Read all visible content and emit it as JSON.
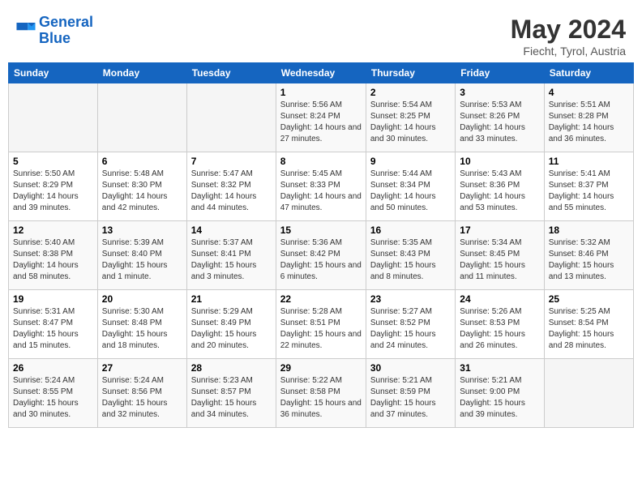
{
  "logo": {
    "line1": "General",
    "line2": "Blue"
  },
  "title": "May 2024",
  "location": "Fiecht, Tyrol, Austria",
  "days_of_week": [
    "Sunday",
    "Monday",
    "Tuesday",
    "Wednesday",
    "Thursday",
    "Friday",
    "Saturday"
  ],
  "weeks": [
    [
      {
        "num": "",
        "info": ""
      },
      {
        "num": "",
        "info": ""
      },
      {
        "num": "",
        "info": ""
      },
      {
        "num": "1",
        "info": "Sunrise: 5:56 AM\nSunset: 8:24 PM\nDaylight: 14 hours and 27 minutes."
      },
      {
        "num": "2",
        "info": "Sunrise: 5:54 AM\nSunset: 8:25 PM\nDaylight: 14 hours and 30 minutes."
      },
      {
        "num": "3",
        "info": "Sunrise: 5:53 AM\nSunset: 8:26 PM\nDaylight: 14 hours and 33 minutes."
      },
      {
        "num": "4",
        "info": "Sunrise: 5:51 AM\nSunset: 8:28 PM\nDaylight: 14 hours and 36 minutes."
      }
    ],
    [
      {
        "num": "5",
        "info": "Sunrise: 5:50 AM\nSunset: 8:29 PM\nDaylight: 14 hours and 39 minutes."
      },
      {
        "num": "6",
        "info": "Sunrise: 5:48 AM\nSunset: 8:30 PM\nDaylight: 14 hours and 42 minutes."
      },
      {
        "num": "7",
        "info": "Sunrise: 5:47 AM\nSunset: 8:32 PM\nDaylight: 14 hours and 44 minutes."
      },
      {
        "num": "8",
        "info": "Sunrise: 5:45 AM\nSunset: 8:33 PM\nDaylight: 14 hours and 47 minutes."
      },
      {
        "num": "9",
        "info": "Sunrise: 5:44 AM\nSunset: 8:34 PM\nDaylight: 14 hours and 50 minutes."
      },
      {
        "num": "10",
        "info": "Sunrise: 5:43 AM\nSunset: 8:36 PM\nDaylight: 14 hours and 53 minutes."
      },
      {
        "num": "11",
        "info": "Sunrise: 5:41 AM\nSunset: 8:37 PM\nDaylight: 14 hours and 55 minutes."
      }
    ],
    [
      {
        "num": "12",
        "info": "Sunrise: 5:40 AM\nSunset: 8:38 PM\nDaylight: 14 hours and 58 minutes."
      },
      {
        "num": "13",
        "info": "Sunrise: 5:39 AM\nSunset: 8:40 PM\nDaylight: 15 hours and 1 minute."
      },
      {
        "num": "14",
        "info": "Sunrise: 5:37 AM\nSunset: 8:41 PM\nDaylight: 15 hours and 3 minutes."
      },
      {
        "num": "15",
        "info": "Sunrise: 5:36 AM\nSunset: 8:42 PM\nDaylight: 15 hours and 6 minutes."
      },
      {
        "num": "16",
        "info": "Sunrise: 5:35 AM\nSunset: 8:43 PM\nDaylight: 15 hours and 8 minutes."
      },
      {
        "num": "17",
        "info": "Sunrise: 5:34 AM\nSunset: 8:45 PM\nDaylight: 15 hours and 11 minutes."
      },
      {
        "num": "18",
        "info": "Sunrise: 5:32 AM\nSunset: 8:46 PM\nDaylight: 15 hours and 13 minutes."
      }
    ],
    [
      {
        "num": "19",
        "info": "Sunrise: 5:31 AM\nSunset: 8:47 PM\nDaylight: 15 hours and 15 minutes."
      },
      {
        "num": "20",
        "info": "Sunrise: 5:30 AM\nSunset: 8:48 PM\nDaylight: 15 hours and 18 minutes."
      },
      {
        "num": "21",
        "info": "Sunrise: 5:29 AM\nSunset: 8:49 PM\nDaylight: 15 hours and 20 minutes."
      },
      {
        "num": "22",
        "info": "Sunrise: 5:28 AM\nSunset: 8:51 PM\nDaylight: 15 hours and 22 minutes."
      },
      {
        "num": "23",
        "info": "Sunrise: 5:27 AM\nSunset: 8:52 PM\nDaylight: 15 hours and 24 minutes."
      },
      {
        "num": "24",
        "info": "Sunrise: 5:26 AM\nSunset: 8:53 PM\nDaylight: 15 hours and 26 minutes."
      },
      {
        "num": "25",
        "info": "Sunrise: 5:25 AM\nSunset: 8:54 PM\nDaylight: 15 hours and 28 minutes."
      }
    ],
    [
      {
        "num": "26",
        "info": "Sunrise: 5:24 AM\nSunset: 8:55 PM\nDaylight: 15 hours and 30 minutes."
      },
      {
        "num": "27",
        "info": "Sunrise: 5:24 AM\nSunset: 8:56 PM\nDaylight: 15 hours and 32 minutes."
      },
      {
        "num": "28",
        "info": "Sunrise: 5:23 AM\nSunset: 8:57 PM\nDaylight: 15 hours and 34 minutes."
      },
      {
        "num": "29",
        "info": "Sunrise: 5:22 AM\nSunset: 8:58 PM\nDaylight: 15 hours and 36 minutes."
      },
      {
        "num": "30",
        "info": "Sunrise: 5:21 AM\nSunset: 8:59 PM\nDaylight: 15 hours and 37 minutes."
      },
      {
        "num": "31",
        "info": "Sunrise: 5:21 AM\nSunset: 9:00 PM\nDaylight: 15 hours and 39 minutes."
      },
      {
        "num": "",
        "info": ""
      }
    ]
  ]
}
